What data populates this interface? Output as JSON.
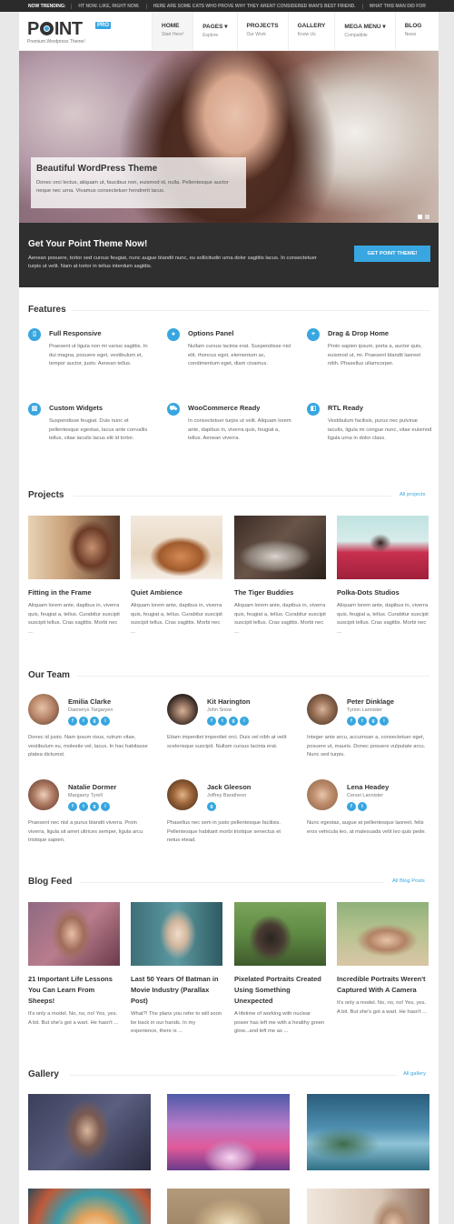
{
  "trending": {
    "label": "NOW TRENDING:",
    "items": [
      "HT NOW. LIKE, RIGHT NOW.",
      "HERE ARE SOME CATS WHO PROVE WHY THEY ARENT CONSIDERED MAN'S BEST FRIEND.",
      "WHAT THIS MAN DID FOR"
    ]
  },
  "header": {
    "logo": {
      "p": "P",
      "rest": "INT",
      "badge": "PRO"
    },
    "tagline": "Premium Wordpress Theme!",
    "nav": [
      {
        "title": "HOME",
        "sub": "Start Here!"
      },
      {
        "title": "PAGES ▾",
        "sub": "Explore"
      },
      {
        "title": "PROJECTS",
        "sub": "Our Work"
      },
      {
        "title": "GALLERY",
        "sub": "Know Us"
      },
      {
        "title": "MEGA MENU ▾",
        "sub": "Compatible"
      },
      {
        "title": "BLOG",
        "sub": "News"
      }
    ]
  },
  "hero": {
    "title": "Beautiful WordPress Theme",
    "text": "Donec orci lectus, aliquam ut, faucibus non, euismod id, nulla. Pellentesque auctor neque nec urna. Vivamus consectetuer hendrerit lacus."
  },
  "cta": {
    "title": "Get Your Point Theme Now!",
    "text": "Aenean posuere, tortor sed cursus feugiat, nunc augue blandit nunc, eu sollicitudin urna dolor sagittis lacus. In consectetuer turpis ut velit. Nam at tortor in tellus interdum sagittis.",
    "button": "GET POINT THEME!"
  },
  "features": {
    "title": "Features",
    "items": [
      {
        "icon": "mobile-icon",
        "glyph": "▯",
        "title": "Full Responsive",
        "text": "Praesent ut ligula non mi varius sagittis. In dui magna, posuere eget, vestibulum et, tempor auctor, justo. Aenean tellus."
      },
      {
        "icon": "settings-icon",
        "glyph": "●",
        "title": "Options Panel",
        "text": "Nullam cursus lacinia erat. Suspendisse nisl elit, rhoncus eget, elementum ac, condimentum eget, diam civamus."
      },
      {
        "icon": "plus-icon",
        "glyph": "+",
        "title": "Drag & Drop Home",
        "text": "Proin sapien ipsum, porta a, auctor quis, euismod ut, mi. Praesent blandit laoreet nibh. Phasellus ullamcorper."
      },
      {
        "icon": "widgets-icon",
        "glyph": "▥",
        "title": "Custom Widgets",
        "text": "Suspendisse feugiat. Duis nunc et pellentesque egestas, lacus ante convallis tellus, vitae iaculis lacus elit id tortor."
      },
      {
        "icon": "cart-icon",
        "glyph": "⛟",
        "title": "WooCommerce Ready",
        "text": "In consectetuer turpis ut velit. Aliquam lorem ante, dapibus in, viverra quis, feugiat a, tellus. Aenean viverra."
      },
      {
        "icon": "rtl-icon",
        "glyph": "◧",
        "title": "RTL Ready",
        "text": "Vestibulum facilisis, purus nec pulvinar iaculis, ligula mi congue nunc, vitae euismod ligula urna in dolor class."
      }
    ]
  },
  "projects": {
    "title": "Projects",
    "link": "All projects",
    "items": [
      {
        "title": "Fitting in the Frame",
        "text": "Aliquam lorem ante, dapibus in, viverra quis, feugiat a, tellus. Curabitur suscipit suscipit tellus. Cras sagittis. Morbi nec ..."
      },
      {
        "title": "Quiet Ambience",
        "text": "Aliquam lorem ante, dapibus in, viverra quis, feugiat a, tellus. Curabitur suscipit suscipit tellus. Cras sagittis. Morbi nec ..."
      },
      {
        "title": "The Tiger Buddies",
        "text": "Aliquam lorem ante, dapibus in, viverra quis, feugiat a, tellus. Curabitur suscipit suscipit tellus. Cras sagittis. Morbi nec ..."
      },
      {
        "title": "Polka-Dots Studios",
        "text": "Aliquam lorem ante, dapibus in, viverra quis, feugiat a, tellus. Curabitur suscipit suscipit tellus. Cras sagittis. Morbi nec ..."
      }
    ]
  },
  "team": {
    "title": "Our Team",
    "members": [
      {
        "name": "Emilia Clarke",
        "role": "Daenerys Targaryen",
        "social": [
          "f",
          "t",
          "g",
          "i"
        ],
        "text": "Donec id justo. Nam ipsum risus, rutrum vitae, vestibulum eu, molestie vel, lacus. In hac habitasse platea dictumst."
      },
      {
        "name": "Kit Harington",
        "role": "John Snow",
        "social": [
          "f",
          "t",
          "g",
          "i"
        ],
        "text": "Etiam imperdiet imperdiet orci. Duis vel nibh at velit scelerisque suscipit. Nullam cursus lacinia erat."
      },
      {
        "name": "Peter Dinklage",
        "role": "Tyrion Lannister",
        "social": [
          "f",
          "t",
          "g",
          "i"
        ],
        "text": "Integer ante arcu, accumsan a, consectetuer eget, posuere ut, mauris. Donec posuere vulputate arcu. Nunc sed turpis."
      },
      {
        "name": "Natalie Dormer",
        "role": "Margaery Tyrell",
        "social": [
          "f",
          "t",
          "g",
          "i"
        ],
        "text": "Praesent nec nisl a purus blandit viverra. Proin viverra, ligula sit amet ultrices semper, ligula arcu tristique sapien."
      },
      {
        "name": "Jack Gleeson",
        "role": "Joffrey Baratheon",
        "social": [
          "g"
        ],
        "text": "Phasellus nec sem in justo pellentesque facilisis. Pellentesque habitant morbi tristique senectus et netus etead."
      },
      {
        "name": "Lena Headey",
        "role": "Cersei Lannister",
        "social": [
          "f",
          "t"
        ],
        "text": "Nunc egestas, augue at pellentesque laoreet, felis eros vehicula leo, at malesuada velit leo quis pede."
      }
    ]
  },
  "blog": {
    "title": "Blog Feed",
    "link": "All Blog Posts",
    "items": [
      {
        "title": "21 Important Life Lessons You Can Learn From Sheeps!",
        "text": "It's only a model. No, no, no! Yes, yes. A bit. But she's got a wart. He hasn't ..."
      },
      {
        "title": "Last 50 Years Of Batman in Movie Industry (Parallax Post)",
        "text": "What?! The plans you refer to will soon be back in our hands. In my experience, there is ..."
      },
      {
        "title": "Pixelated Portraits Created Using Something Unexpected",
        "text": "A lifetime of working with nuclear power has left me with a healthy green glow...and left me as ..."
      },
      {
        "title": "Incredible Portraits Weren't Captured With A Camera",
        "text": "It's only a model. No, no, no! Yes, yes. A bit. But she's got a wart. He hasn't ..."
      }
    ]
  },
  "gallery": {
    "title": "Gallery",
    "link": "All gallery"
  },
  "colors": {
    "accent": "#38a6e0",
    "dark": "#2f2f2f"
  }
}
